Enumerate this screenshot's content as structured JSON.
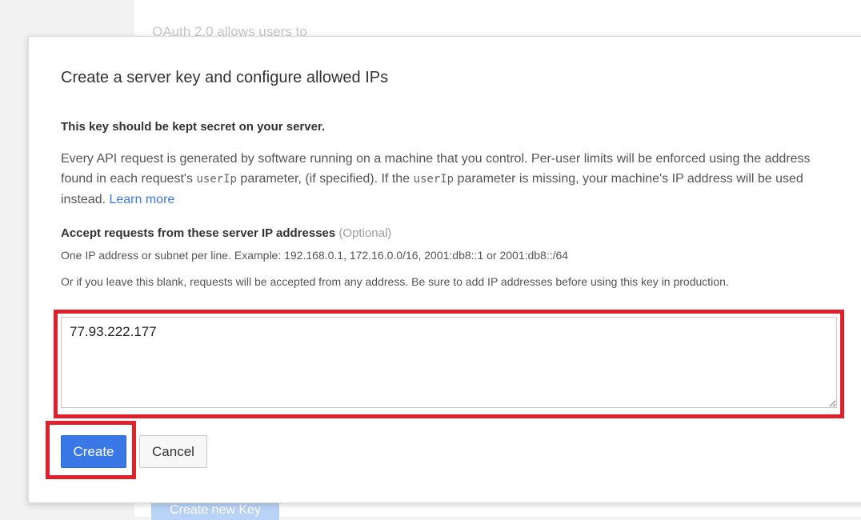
{
  "background": {
    "partial_text": "OAuth 2.0 allows users to",
    "create_new_key_label": "Create new Key"
  },
  "dialog": {
    "title": "Create a server key and configure allowed IPs",
    "secret_heading": "This key should be kept secret on your server.",
    "description": {
      "part1": "Every API request is generated by software running on a machine that you control. Per-user limits will be enforced using the address found in each request's ",
      "code1": "userIp",
      "part2": " parameter, (if specified). If the ",
      "code2": "userIp",
      "part3": " parameter is missing, your machine's IP address will be used instead. ",
      "learn_more": "Learn more"
    },
    "ip_field": {
      "label": "Accept requests from these server IP addresses",
      "optional": "(Optional)",
      "hint": "One IP address or subnet per line. Example: 192.168.0.1, 172.16.0.0/16, 2001:db8::1 or 2001:db8::/64",
      "note": "Or if you leave this blank, requests will be accepted from any address. Be sure to add IP addresses before using this key in production.",
      "value": "77.93.222.177"
    },
    "buttons": {
      "create": "Create",
      "cancel": "Cancel"
    }
  },
  "colors": {
    "accent": "#3b78e7",
    "highlight": "#e0202a"
  }
}
